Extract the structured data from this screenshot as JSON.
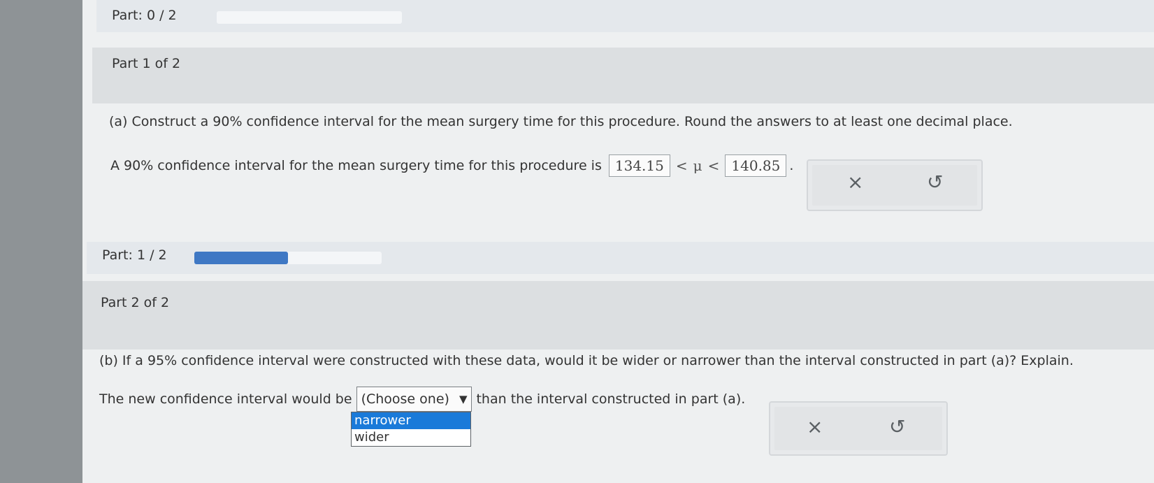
{
  "part_progress_1": {
    "label": "Part: 0 / 2",
    "fraction": 0.0
  },
  "part_1": {
    "header": "Part 1 of 2",
    "question": "(a) Construct a 90% confidence interval for the mean surgery time for this procedure. Round the answers to at least one decimal place.",
    "answer_prefix": "A 90% confidence interval for the mean surgery time for this procedure is",
    "lower_value": "134.15",
    "inequality_left": "<",
    "mu_symbol": "μ",
    "inequality_right": "<",
    "upper_value": "140.85",
    "answer_suffix": ".",
    "clear_icon": "×",
    "undo_icon": "↺"
  },
  "part_progress_2": {
    "label": "Part: 1 / 2",
    "fraction": 0.5
  },
  "part_2": {
    "header": "Part 2 of 2",
    "question": "(b) If a 95% confidence interval were constructed with these data, would it be wider or narrower than the interval constructed in part (a)? Explain.",
    "answer_prefix": "The new confidence interval would be",
    "select_value": "(Choose one)",
    "select_caret": "▼",
    "answer_suffix": "than the interval constructed in part (a).",
    "options": [
      "narrower",
      "wider"
    ],
    "highlighted_option": "narrower",
    "clear_icon": "×",
    "undo_icon": "↺"
  }
}
